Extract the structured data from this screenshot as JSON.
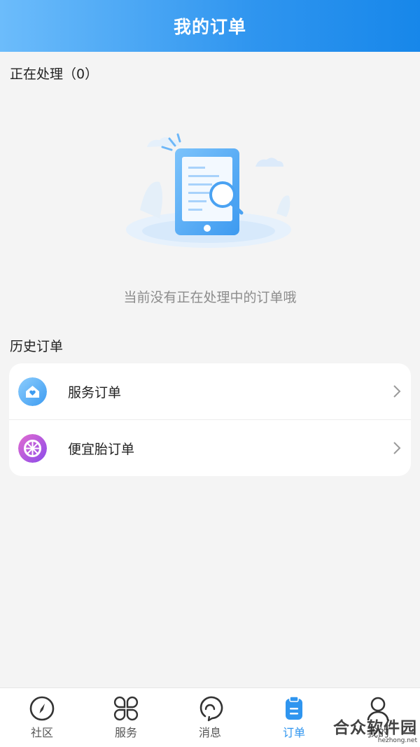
{
  "header": {
    "title": "我的订单"
  },
  "processing": {
    "title": "正在处理（0）",
    "empty_text": "当前没有正在处理中的订单哦"
  },
  "history": {
    "title": "历史订单",
    "items": [
      {
        "label": "服务订单",
        "icon": "house-heart-icon"
      },
      {
        "label": "便宜胎订单",
        "icon": "tire-icon"
      }
    ]
  },
  "tabbar": {
    "items": [
      {
        "label": "社区",
        "icon": "compass-icon",
        "active": false
      },
      {
        "label": "服务",
        "icon": "grid-petals-icon",
        "active": false
      },
      {
        "label": "消息",
        "icon": "chat-icon",
        "active": false
      },
      {
        "label": "订单",
        "icon": "clipboard-icon",
        "active": true
      },
      {
        "label": "我的",
        "icon": "person-icon",
        "active": false
      }
    ]
  },
  "watermark": {
    "main": "合众软件园",
    "sub": "hezhong.net"
  },
  "colors": {
    "accent": "#2f95ef",
    "header_start": "#6cbcfb",
    "header_end": "#1787ea"
  }
}
